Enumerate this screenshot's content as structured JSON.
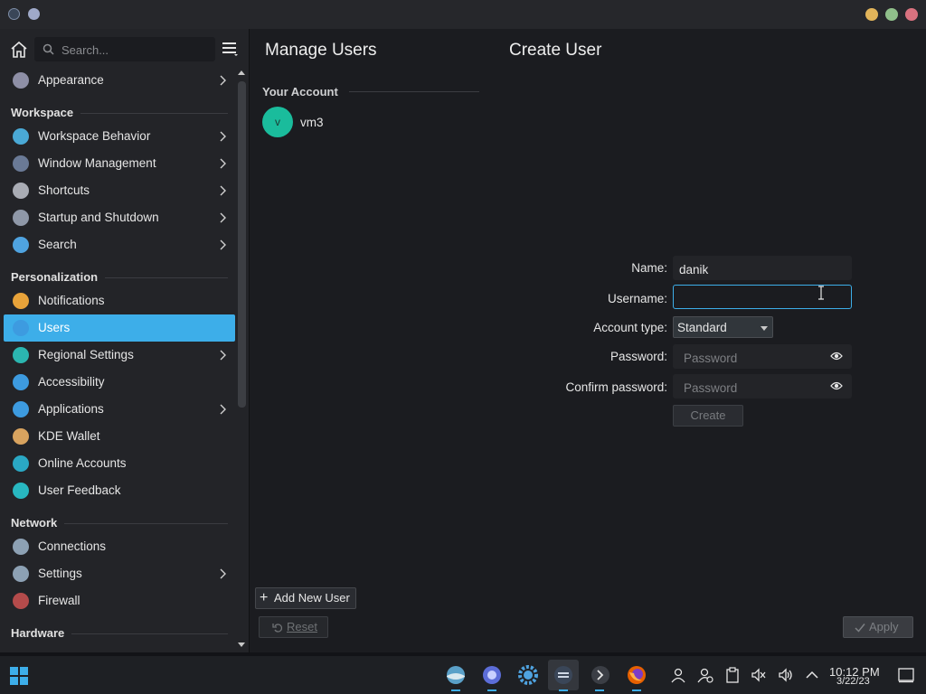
{
  "colors": {
    "accent": "#3daee9",
    "window_bg": "#1b1c20",
    "sidebar_bg": "#232428"
  },
  "sidebar": {
    "search_placeholder": "Search...",
    "top_item": {
      "label": "Appearance",
      "icon": "appearance-icon"
    },
    "sections": [
      {
        "title": "Workspace",
        "items": [
          {
            "label": "Workspace Behavior",
            "icon": "workspace-behavior-icon",
            "chevron": true
          },
          {
            "label": "Window Management",
            "icon": "window-management-icon",
            "chevron": true
          },
          {
            "label": "Shortcuts",
            "icon": "keyboard-icon",
            "chevron": true
          },
          {
            "label": "Startup and Shutdown",
            "icon": "startup-icon",
            "chevron": true
          },
          {
            "label": "Search",
            "icon": "search-icon",
            "chevron": true
          }
        ]
      },
      {
        "title": "Personalization",
        "items": [
          {
            "label": "Notifications",
            "icon": "bell-icon",
            "chevron": false
          },
          {
            "label": "Users",
            "icon": "users-icon",
            "chevron": false,
            "active": true
          },
          {
            "label": "Regional Settings",
            "icon": "regional-icon",
            "chevron": true
          },
          {
            "label": "Accessibility",
            "icon": "accessibility-icon",
            "chevron": false
          },
          {
            "label": "Applications",
            "icon": "applications-icon",
            "chevron": true
          },
          {
            "label": "KDE Wallet",
            "icon": "wallet-icon",
            "chevron": false
          },
          {
            "label": "Online Accounts",
            "icon": "online-accounts-icon",
            "chevron": false
          },
          {
            "label": "User Feedback",
            "icon": "feedback-icon",
            "chevron": false
          }
        ]
      },
      {
        "title": "Network",
        "items": [
          {
            "label": "Connections",
            "icon": "network-icon",
            "chevron": false
          },
          {
            "label": "Settings",
            "icon": "network-settings-icon",
            "chevron": true
          },
          {
            "label": "Firewall",
            "icon": "firewall-icon",
            "chevron": false
          }
        ]
      },
      {
        "title": "Hardware",
        "items": []
      }
    ]
  },
  "main": {
    "title_left": "Manage Users",
    "title_right": "Create User",
    "your_account_label": "Your Account",
    "account": {
      "initial": "v",
      "name": "vm3"
    },
    "form": {
      "name_label": "Name:",
      "name_value": "danik",
      "username_label": "Username:",
      "username_value": "",
      "account_type_label": "Account type:",
      "account_type_value": "Standard",
      "password_label": "Password:",
      "password_placeholder": "Password",
      "confirm_label": "Confirm password:",
      "confirm_placeholder": "Password",
      "create_label": "Create"
    },
    "add_user_label": "Add New User",
    "reset_label": "Reset",
    "apply_label": "Apply"
  },
  "taskbar": {
    "time": "10:12 PM",
    "date": "3/22/23"
  }
}
